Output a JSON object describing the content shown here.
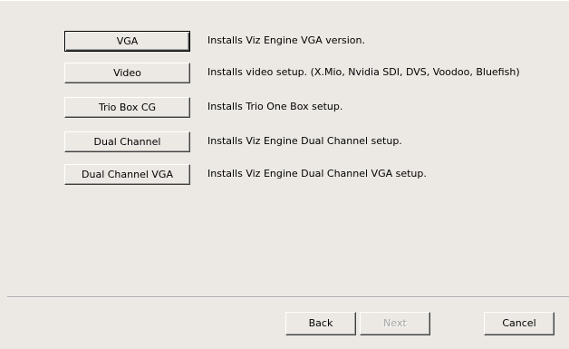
{
  "options": [
    {
      "label": "VGA",
      "description": "Installs Viz Engine VGA version."
    },
    {
      "label": "Video",
      "description": "Installs video setup. (X.Mio, Nvidia SDI, DVS, Voodoo, Bluefish)"
    },
    {
      "label": "Trio Box CG",
      "description": "Installs Trio One Box setup."
    },
    {
      "label": "Dual Channel",
      "description": "Installs Viz Engine Dual Channel setup."
    },
    {
      "label": "Dual Channel VGA",
      "description": "Installs Viz Engine Dual Channel VGA setup."
    }
  ],
  "footer": {
    "back_label": "Back",
    "next_label": "Next",
    "cancel_label": "Cancel"
  },
  "colors": {
    "dialog_background": "#ece9e4",
    "disabled_text": "#a3a3a3"
  }
}
